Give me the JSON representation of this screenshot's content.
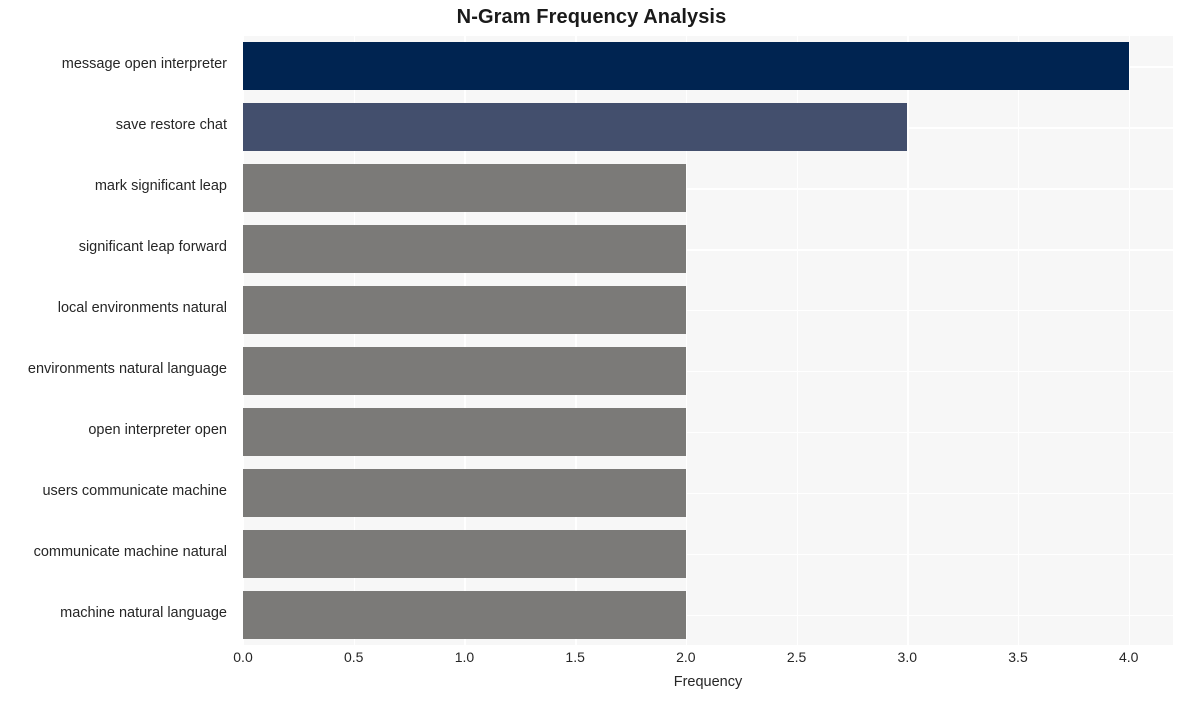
{
  "chart_data": {
    "type": "bar",
    "orientation": "horizontal",
    "title": "N-Gram Frequency Analysis",
    "xlabel": "Frequency",
    "ylabel": "",
    "xlim": [
      0,
      4.2
    ],
    "xticks": [
      "0.0",
      "0.5",
      "1.0",
      "1.5",
      "2.0",
      "2.5",
      "3.0",
      "3.5",
      "4.0"
    ],
    "xtick_values": [
      0,
      0.5,
      1,
      1.5,
      2,
      2.5,
      3,
      3.5,
      4
    ],
    "grid": true,
    "legend": "none",
    "categories": [
      "message open interpreter",
      "save restore chat",
      "mark significant leap",
      "significant leap forward",
      "local environments natural",
      "environments natural language",
      "open interpreter open",
      "users communicate machine",
      "communicate machine natural",
      "machine natural language"
    ],
    "values": [
      4,
      3,
      2,
      2,
      2,
      2,
      2,
      2,
      2,
      2
    ],
    "bar_colors": [
      "#002451",
      "#434f6d",
      "#7b7a78",
      "#7b7a78",
      "#7b7a78",
      "#7b7a78",
      "#7b7a78",
      "#7b7a78",
      "#7b7a78",
      "#7b7a78"
    ]
  },
  "style": {
    "plot_background": "#f7f7f7",
    "figure_background": "#ffffff",
    "gridline_color": "#ffffff",
    "text_color": "#262626"
  }
}
